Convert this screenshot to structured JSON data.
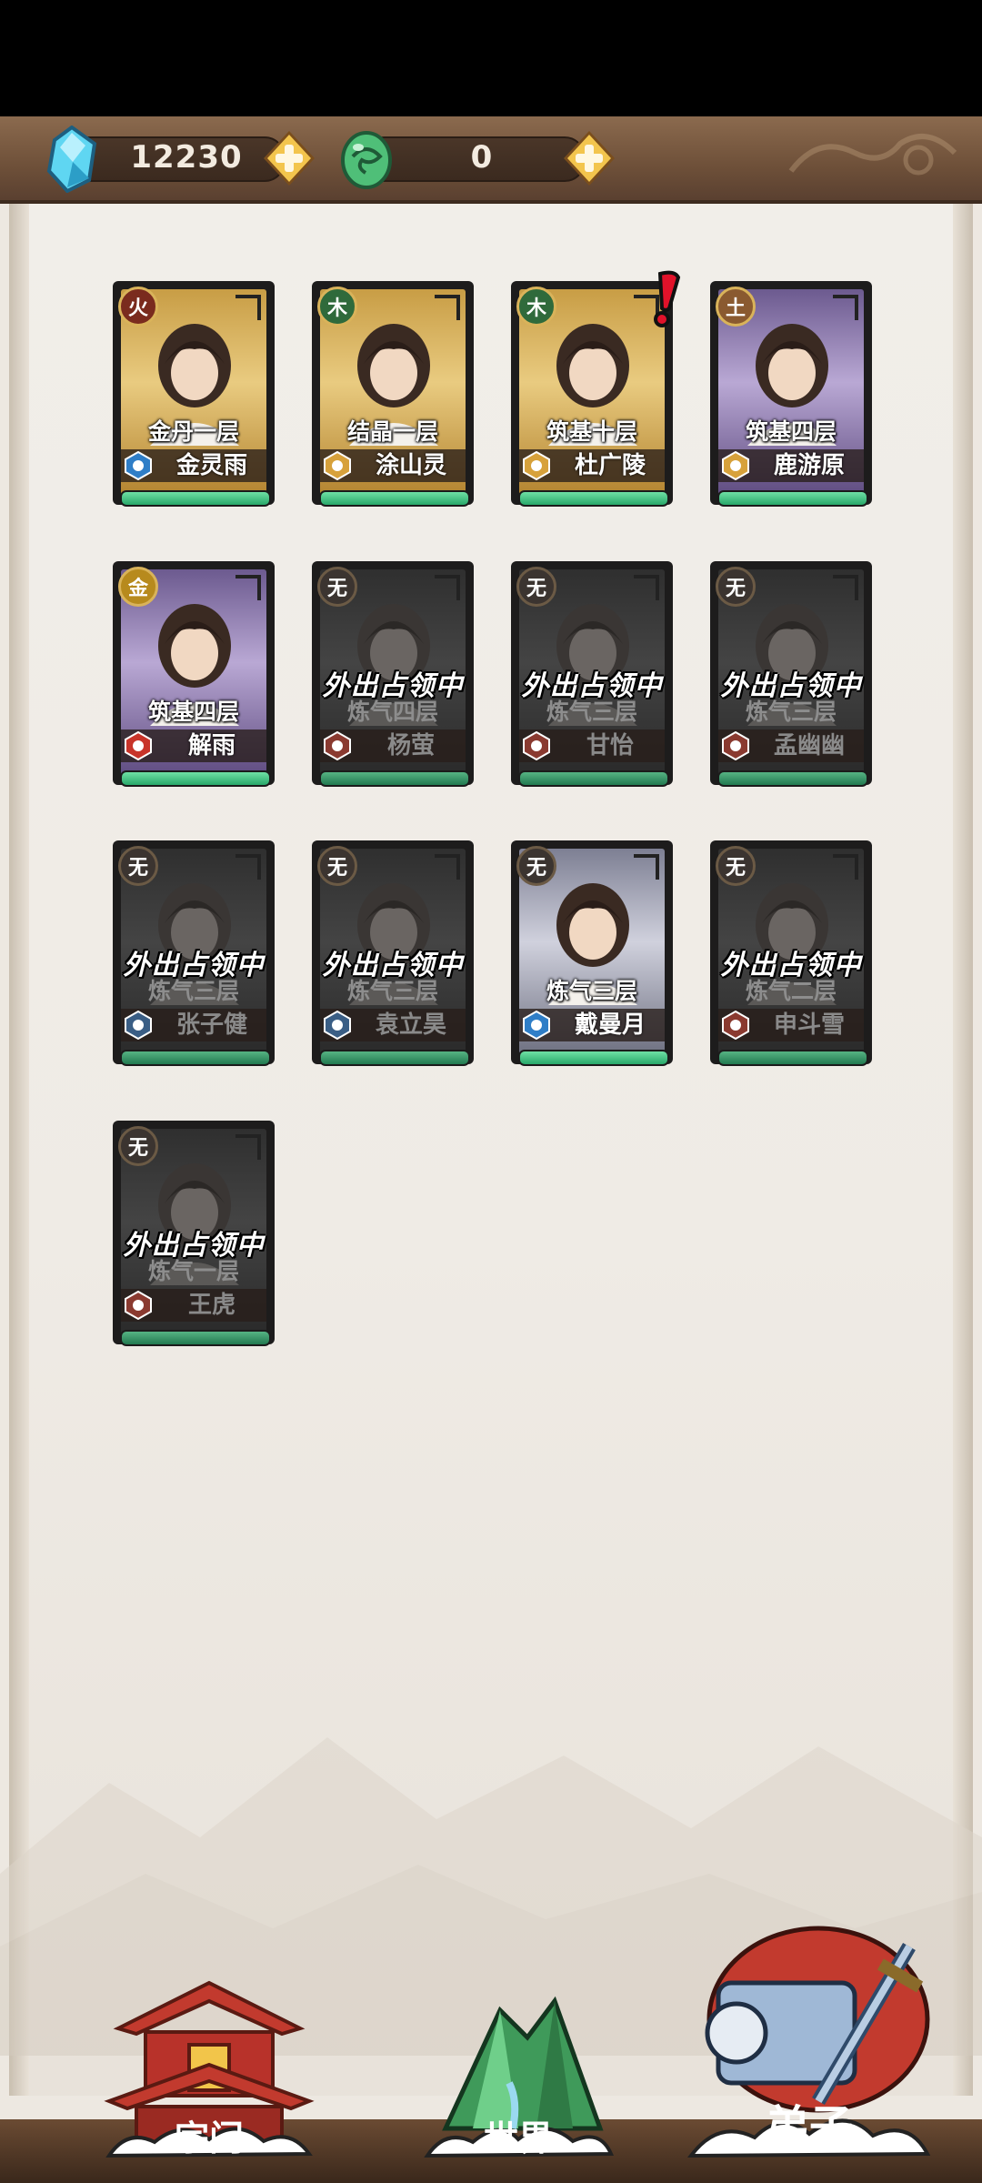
{
  "currency": {
    "spirit_stones": "12230",
    "spirit_eggs": "0"
  },
  "disciples": [
    {
      "element": "火",
      "element_class": "el-fire",
      "realm": "金丹一层",
      "name": "金灵雨",
      "status": "",
      "card_style": "gold",
      "role_color": "#2f7ec7",
      "alert": false
    },
    {
      "element": "木",
      "element_class": "el-wood",
      "realm": "结晶一层",
      "name": "涂山灵",
      "status": "",
      "card_style": "gold",
      "role_color": "#d7a13b",
      "alert": false
    },
    {
      "element": "木",
      "element_class": "el-wood",
      "realm": "筑基十层",
      "name": "杜广陵",
      "status": "",
      "card_style": "gold",
      "role_color": "#d7a13b",
      "alert": true
    },
    {
      "element": "土",
      "element_class": "el-earth",
      "realm": "筑基四层",
      "name": "鹿游原",
      "status": "",
      "card_style": "purple",
      "role_color": "#d7a13b",
      "alert": false
    },
    {
      "element": "金",
      "element_class": "el-metal",
      "realm": "筑基四层",
      "name": "解雨",
      "status": "",
      "card_style": "purple",
      "role_color": "#c8342a",
      "alert": false
    },
    {
      "element": "无",
      "element_class": "el-none",
      "realm": "炼气四层",
      "name": "杨萤",
      "status": "外出占领中",
      "card_style": "dim",
      "role_color": "#8a3a30",
      "alert": false
    },
    {
      "element": "无",
      "element_class": "el-none",
      "realm": "炼气三层",
      "name": "甘怡",
      "status": "外出占领中",
      "card_style": "dim",
      "role_color": "#8a3a30",
      "alert": false
    },
    {
      "element": "无",
      "element_class": "el-none",
      "realm": "炼气三层",
      "name": "孟幽幽",
      "status": "外出占领中",
      "card_style": "dim",
      "role_color": "#8a3a30",
      "alert": false
    },
    {
      "element": "无",
      "element_class": "el-none",
      "realm": "炼气三层",
      "name": "张子健",
      "status": "外出占领中",
      "card_style": "dim",
      "role_color": "#3a5e85",
      "alert": false
    },
    {
      "element": "无",
      "element_class": "el-none",
      "realm": "炼气三层",
      "name": "袁立昊",
      "status": "外出占领中",
      "card_style": "dim",
      "role_color": "#3a5e85",
      "alert": false
    },
    {
      "element": "无",
      "element_class": "el-none",
      "realm": "炼气三层",
      "name": "戴曼月",
      "status": "",
      "card_style": "silver",
      "role_color": "#2f7ec7",
      "alert": false
    },
    {
      "element": "无",
      "element_class": "el-none",
      "realm": "炼气二层",
      "name": "申斗雪",
      "status": "外出占领中",
      "card_style": "dim",
      "role_color": "#8a3a30",
      "alert": false
    },
    {
      "element": "无",
      "element_class": "el-none",
      "realm": "炼气一层",
      "name": "王虎",
      "status": "外出占领中",
      "card_style": "dim",
      "role_color": "#8a3a30",
      "alert": false
    }
  ],
  "nav": {
    "sect": "宗门",
    "world": "世界",
    "disciples": "弟子"
  }
}
